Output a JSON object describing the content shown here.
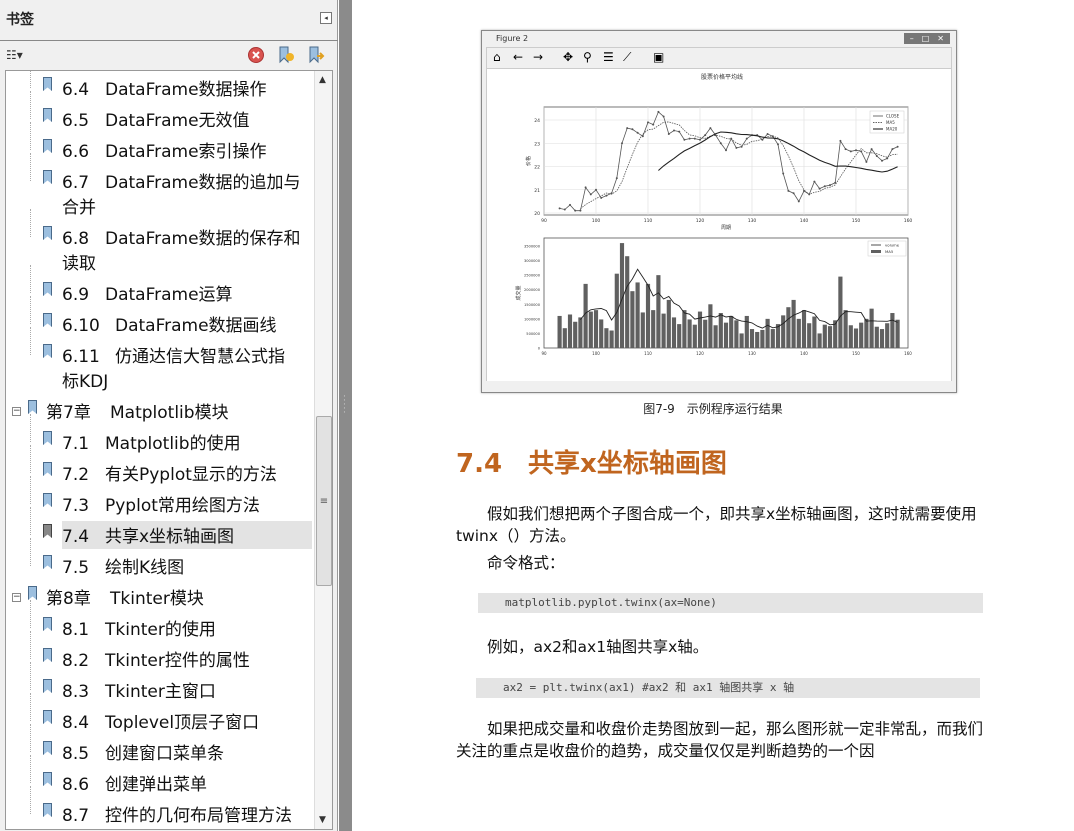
{
  "sidebar": {
    "title": "书签",
    "options_icon": "options-menu-icon",
    "toolbar_icons": [
      "delete-bookmark-icon",
      "new-bookmark-icon",
      "expand-bookmark-icon"
    ],
    "items": [
      {
        "num": "6.4",
        "label": "DataFrame数据操作",
        "level": 2
      },
      {
        "num": "6.5",
        "label": "DataFrame无效值",
        "level": 2
      },
      {
        "num": "6.6",
        "label": "DataFrame索引操作",
        "level": 2
      },
      {
        "num": "6.7",
        "label": "DataFrame数据的追加与",
        "cont": "合并",
        "level": 2
      },
      {
        "num": "6.8",
        "label": "DataFrame数据的保存和",
        "cont": "读取",
        "level": 2
      },
      {
        "num": "6.9",
        "label": "DataFrame运算",
        "level": 2
      },
      {
        "num": "6.10",
        "label": "DataFrame数据画线",
        "level": 2
      },
      {
        "num": "6.11",
        "label": "仿通达信大智慧公式指",
        "cont": "标KDJ",
        "level": 2
      },
      {
        "num": "第7章",
        "label": "Matplotlib模块",
        "level": 1
      },
      {
        "num": "7.1",
        "label": "Matplotlib的使用",
        "level": 2
      },
      {
        "num": "7.2",
        "label": "有关Pyplot显示的方法",
        "level": 2
      },
      {
        "num": "7.3",
        "label": "Pyplot常用绘图方法",
        "level": 2
      },
      {
        "num": "7.4",
        "label": "共享x坐标轴画图",
        "level": 2,
        "selected": true
      },
      {
        "num": "7.5",
        "label": "绘制K线图",
        "level": 2
      },
      {
        "num": "第8章",
        "label": "Tkinter模块",
        "level": 1
      },
      {
        "num": "8.1",
        "label": "Tkinter的使用",
        "level": 2
      },
      {
        "num": "8.2",
        "label": "Tkinter控件的属性",
        "level": 2
      },
      {
        "num": "8.3",
        "label": "Tkinter主窗口",
        "level": 2
      },
      {
        "num": "8.4",
        "label": "Toplevel顶层子窗口",
        "level": 2
      },
      {
        "num": "8.5",
        "label": "创建窗口菜单条",
        "level": 2
      },
      {
        "num": "8.6",
        "label": "创建弹出菜单",
        "level": 2
      },
      {
        "num": "8.7",
        "label": "控件的几何布局管理方法",
        "level": 2
      }
    ]
  },
  "figure": {
    "window_title": "Figure 2",
    "caption": "图7-9　示例程序运行结果"
  },
  "chart_data": [
    {
      "type": "line",
      "title": "股票价格平均线",
      "xlabel": "周期",
      "ylabel": "价格",
      "xlim": [
        90,
        160
      ],
      "ylim": [
        19.9,
        24.6
      ],
      "xticks": [
        "90",
        "100",
        "110",
        "120",
        "130",
        "140",
        "150",
        "160"
      ],
      "yticks": [
        "20",
        "21",
        "22",
        "23",
        "24"
      ],
      "legend": [
        "CLOSE",
        "MA5",
        "MA20"
      ],
      "legend_position": "top-right",
      "x_start": 93,
      "close": [
        20.2,
        20.15,
        20.35,
        20.1,
        20.1,
        21.1,
        20.8,
        21.0,
        20.65,
        20.75,
        20.85,
        21.5,
        23.0,
        23.65,
        23.6,
        23.45,
        23.3,
        23.9,
        23.8,
        24.35,
        24.15,
        23.4,
        23.55,
        23.5,
        23.15,
        23.2,
        23.2,
        23.15,
        23.35,
        23.65,
        23.35,
        23.0,
        22.7,
        23.2,
        22.8,
        22.85,
        23.2,
        23.35,
        23.35,
        23.15,
        23.4,
        23.3,
        22.95,
        21.7,
        20.95,
        20.85,
        20.5,
        20.95,
        20.8,
        21.35,
        21.05,
        21.15,
        21.2,
        21.3,
        23.1,
        22.75,
        22.65,
        22.7,
        22.65,
        22.2,
        22.75,
        22.45,
        22.25,
        22.35,
        22.75,
        22.85
      ]
    },
    {
      "type": "bar",
      "xlabel": "",
      "ylabel": "成交量",
      "xlim": [
        90,
        160
      ],
      "ylim": [
        0,
        3600000
      ],
      "xticks": [
        "90",
        "100",
        "110",
        "120",
        "130",
        "140",
        "150",
        "160"
      ],
      "yticks": [
        "0",
        "500000",
        "1000000",
        "1500000",
        "2000000",
        "2500000",
        "3000000",
        "3500000"
      ],
      "legend": [
        "volume",
        "MA5"
      ],
      "legend_position": "top-right",
      "x_start": 93,
      "volume": [
        1100000,
        680000,
        1150000,
        900000,
        1050000,
        2200000,
        1250000,
        1300000,
        980000,
        680000,
        600000,
        2550000,
        3600000,
        3150000,
        1950000,
        2250000,
        1220000,
        2200000,
        1300000,
        2500000,
        1180000,
        1650000,
        1050000,
        820000,
        1300000,
        980000,
        800000,
        1250000,
        970000,
        1500000,
        780000,
        1200000,
        870000,
        1100000,
        950000,
        500000,
        1100000,
        650000,
        550000,
        620000,
        1000000,
        650000,
        820000,
        1120000,
        1400000,
        1650000,
        1000000,
        1300000,
        850000,
        1080000,
        500000,
        800000,
        750000,
        950000,
        2450000,
        1300000,
        780000,
        670000,
        870000,
        1000000,
        1350000,
        730000,
        650000,
        850000,
        1200000,
        970000
      ]
    }
  ],
  "content": {
    "heading": "7.4　共享x坐标轴画图",
    "p1": "假如我们想把两个子图合成一个，即共享x坐标轴画图，这时就需要使用twinx（）方法。",
    "p2": "命令格式：",
    "code1": "matplotlib.pyplot.twinx(ax=None)",
    "p3": "例如，ax2和ax1轴图共享x轴。",
    "code2": "ax2 = plt.twinx(ax1)  #ax2 和 ax1 轴图共享 x 轴",
    "p4": "如果把成交量和收盘价走势图放到一起，那么图形就一定非常乱，而我们关注的重点是收盘价的趋势，成交量仅仅是判断趋势的一个因"
  }
}
